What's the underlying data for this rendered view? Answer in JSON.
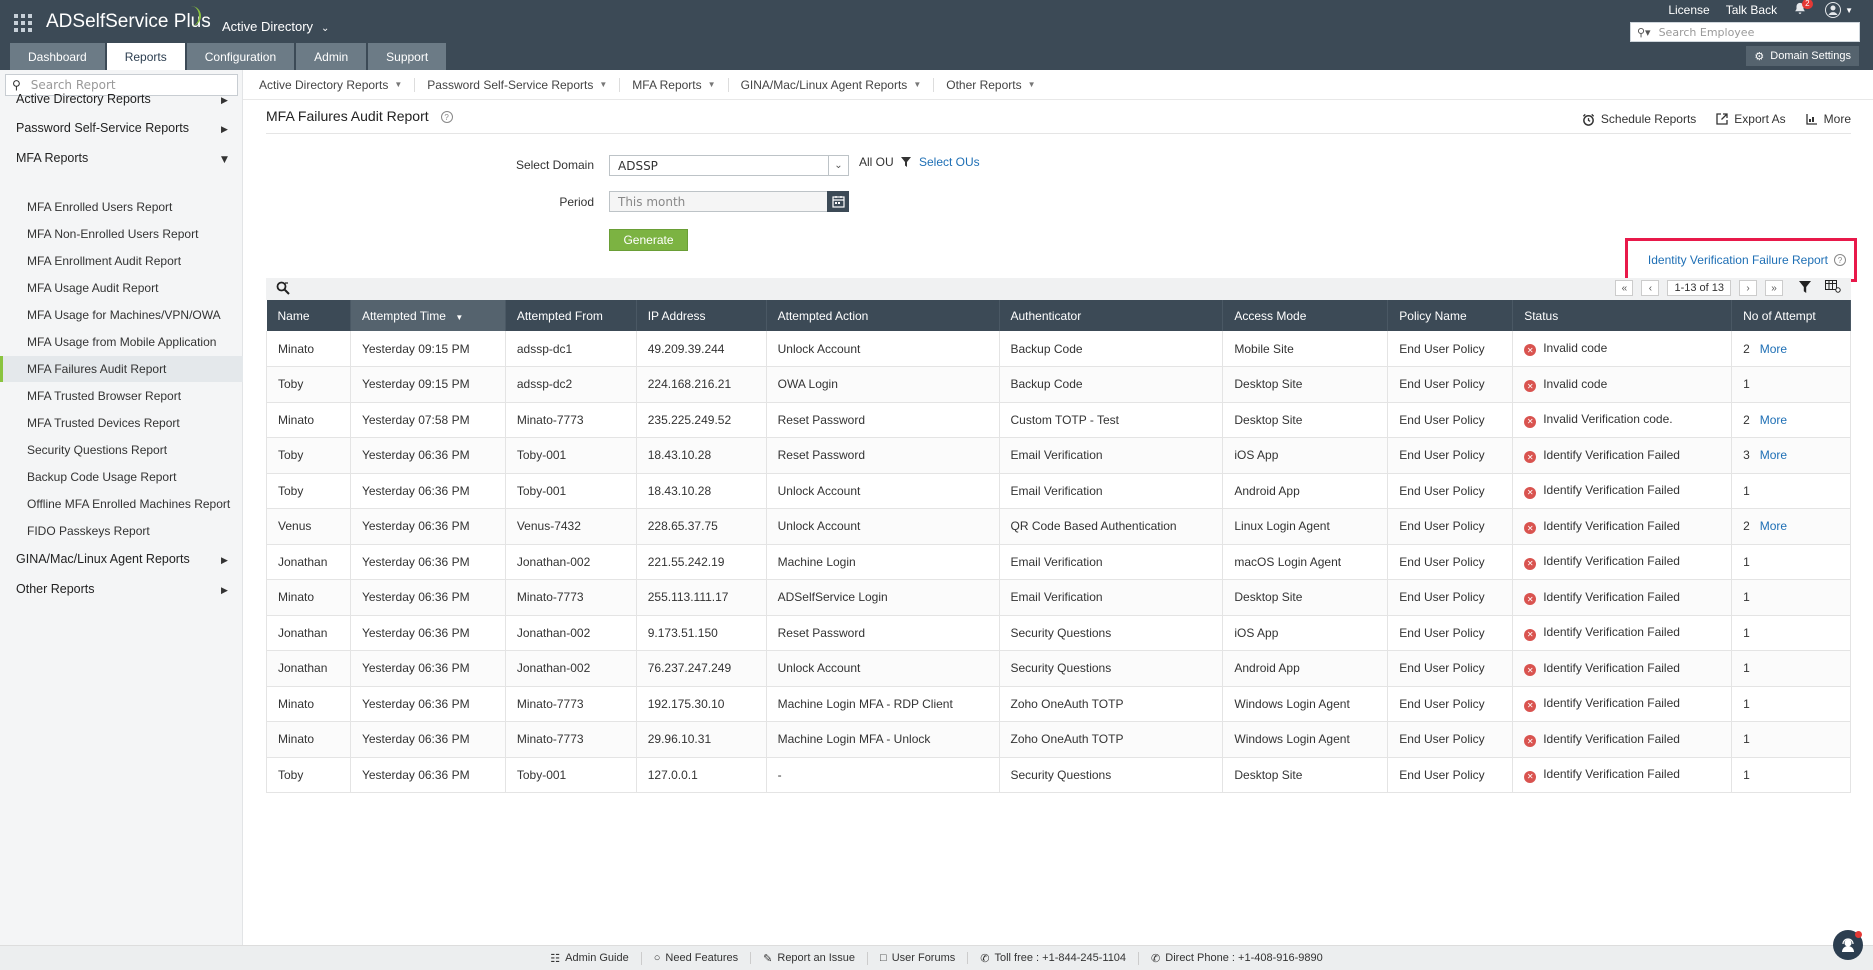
{
  "header": {
    "app_name": "ADSelfService Plus",
    "directory_select": "Active Directory",
    "top_links": {
      "license": "License",
      "talk_back": "Talk Back"
    },
    "notification_count": "2",
    "search_placeholder": "Search Employee",
    "tabs": [
      "Dashboard",
      "Reports",
      "Configuration",
      "Admin",
      "Support"
    ],
    "active_tab": "Reports",
    "domain_settings": "Domain Settings"
  },
  "sidebar": {
    "search_placeholder": "Search Report",
    "groups": [
      {
        "label": "Active Directory Reports"
      },
      {
        "label": "Password Self-Service Reports"
      },
      {
        "label": "MFA Reports"
      },
      {
        "label": "GINA/Mac/Linux Agent Reports"
      },
      {
        "label": "Other Reports"
      }
    ],
    "mfa_items": [
      "MFA Enrolled Users Report",
      "MFA Non-Enrolled Users Report",
      "MFA Enrollment Audit Report",
      "MFA Usage Audit Report",
      "MFA Usage for Machines/VPN/OWA",
      "MFA Usage from Mobile Application",
      "MFA Failures Audit Report",
      "MFA Trusted Browser Report",
      "MFA Trusted Devices Report",
      "Security Questions Report",
      "Backup Code Usage Report",
      "Offline MFA Enrolled Machines Report",
      "FIDO Passkeys Report"
    ]
  },
  "subnav": [
    "Active Directory Reports",
    "Password Self-Service Reports",
    "MFA Reports",
    "GINA/Mac/Linux Agent Reports",
    "Other Reports"
  ],
  "report": {
    "title": "MFA Failures Audit Report",
    "actions": {
      "schedule": "Schedule Reports",
      "export": "Export As",
      "more": "More"
    },
    "form": {
      "domain_label": "Select Domain",
      "domain_value": "ADSSP",
      "all_ou": "All OU",
      "select_ous": "Select OUs",
      "period_label": "Period",
      "period_value": "This month",
      "generate": "Generate"
    },
    "idv_link": "Identity Verification Failure Report",
    "pager": "1-13 of 13"
  },
  "table": {
    "columns": [
      "Name",
      "Attempted Time",
      "Attempted From",
      "IP Address",
      "Attempted Action",
      "Authenticator",
      "Access Mode",
      "Policy Name",
      "Status",
      "No of Attempt"
    ],
    "more_label": "More",
    "rows": [
      {
        "name": "Minato",
        "time": "Yesterday 09:15 PM",
        "from": "adssp-dc1",
        "ip": "49.209.39.244",
        "action": "Unlock Account",
        "auth": "Backup Code",
        "mode": "Mobile Site",
        "policy": "End User Policy",
        "status": "Invalid code",
        "attempts": "2",
        "more": true
      },
      {
        "name": "Toby",
        "time": "Yesterday 09:15 PM",
        "from": "adssp-dc2",
        "ip": "224.168.216.21",
        "action": "OWA Login",
        "auth": "Backup Code",
        "mode": "Desktop Site",
        "policy": "End User Policy",
        "status": "Invalid code",
        "attempts": "1",
        "more": false
      },
      {
        "name": "Minato",
        "time": "Yesterday 07:58 PM",
        "from": "Minato-7773",
        "ip": "235.225.249.52",
        "action": "Reset Password",
        "auth": "Custom TOTP - Test",
        "mode": "Desktop Site",
        "policy": "End User Policy",
        "status": "Invalid Verification code.",
        "attempts": "2",
        "more": true
      },
      {
        "name": "Toby",
        "time": "Yesterday 06:36 PM",
        "from": "Toby-001",
        "ip": "18.43.10.28",
        "action": "Reset Password",
        "auth": "Email Verification",
        "mode": "iOS App",
        "policy": "End User Policy",
        "status": "Identify Verification Failed",
        "attempts": "3",
        "more": true
      },
      {
        "name": "Toby",
        "time": "Yesterday 06:36 PM",
        "from": "Toby-001",
        "ip": "18.43.10.28",
        "action": "Unlock Account",
        "auth": "Email Verification",
        "mode": "Android App",
        "policy": "End User Policy",
        "status": "Identify Verification Failed",
        "attempts": "1",
        "more": false
      },
      {
        "name": "Venus",
        "time": "Yesterday 06:36 PM",
        "from": "Venus-7432",
        "ip": "228.65.37.75",
        "action": "Unlock Account",
        "auth": "QR Code Based Authentication",
        "mode": "Linux Login Agent",
        "policy": "End User Policy",
        "status": "Identify Verification Failed",
        "attempts": "2",
        "more": true
      },
      {
        "name": "Jonathan",
        "time": "Yesterday 06:36 PM",
        "from": "Jonathan-002",
        "ip": "221.55.242.19",
        "action": "Machine Login",
        "auth": "Email Verification",
        "mode": "macOS Login Agent",
        "policy": "End User Policy",
        "status": "Identify Verification Failed",
        "attempts": "1",
        "more": false
      },
      {
        "name": "Minato",
        "time": "Yesterday 06:36 PM",
        "from": "Minato-7773",
        "ip": "255.113.111.17",
        "action": "ADSelfService Login",
        "auth": "Email Verification",
        "mode": "Desktop Site",
        "policy": "End User Policy",
        "status": "Identify Verification Failed",
        "attempts": "1",
        "more": false
      },
      {
        "name": "Jonathan",
        "time": "Yesterday 06:36 PM",
        "from": "Jonathan-002",
        "ip": "9.173.51.150",
        "action": "Reset Password",
        "auth": "Security Questions",
        "mode": "iOS App",
        "policy": "End User Policy",
        "status": "Identify Verification Failed",
        "attempts": "1",
        "more": false
      },
      {
        "name": "Jonathan",
        "time": "Yesterday 06:36 PM",
        "from": "Jonathan-002",
        "ip": "76.237.247.249",
        "action": "Unlock Account",
        "auth": "Security Questions",
        "mode": "Android App",
        "policy": "End User Policy",
        "status": "Identify Verification Failed",
        "attempts": "1",
        "more": false
      },
      {
        "name": "Minato",
        "time": "Yesterday 06:36 PM",
        "from": "Minato-7773",
        "ip": "192.175.30.10",
        "action": "Machine Login MFA - RDP Client",
        "auth": "Zoho OneAuth TOTP",
        "mode": "Windows Login Agent",
        "policy": "End User Policy",
        "status": "Identify Verification Failed",
        "attempts": "1",
        "more": false
      },
      {
        "name": "Minato",
        "time": "Yesterday 06:36 PM",
        "from": "Minato-7773",
        "ip": "29.96.10.31",
        "action": "Machine Login MFA - Unlock",
        "auth": "Zoho OneAuth TOTP",
        "mode": "Windows Login Agent",
        "policy": "End User Policy",
        "status": "Identify Verification Failed",
        "attempts": "1",
        "more": false
      },
      {
        "name": "Toby",
        "time": "Yesterday 06:36 PM",
        "from": "Toby-001",
        "ip": "127.0.0.1",
        "action": "-",
        "auth": "Security Questions",
        "mode": "Desktop Site",
        "policy": "End User Policy",
        "status": "Identify Verification Failed",
        "attempts": "1",
        "more": false
      }
    ]
  },
  "footer": {
    "admin_guide": "Admin Guide",
    "need_features": "Need Features",
    "report_issue": "Report an Issue",
    "user_forums": "User Forums",
    "toll_free": "Toll free : +1-844-245-1104",
    "direct_phone": "Direct Phone : +1-408-916-9890"
  }
}
